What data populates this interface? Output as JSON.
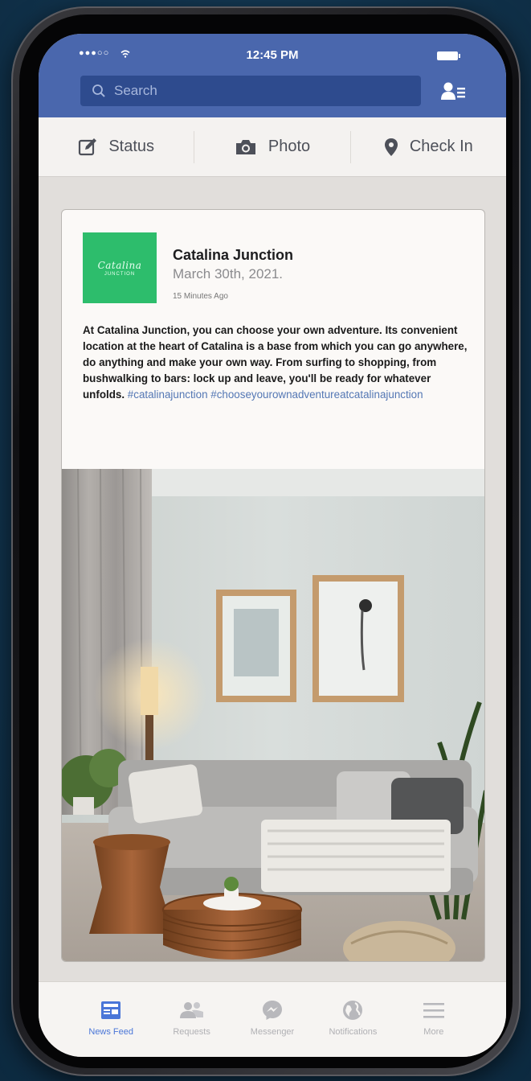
{
  "status_bar": {
    "signal": "●●●○○",
    "time": "12:45 PM"
  },
  "search": {
    "placeholder": "Search"
  },
  "actions": [
    {
      "label": "Status",
      "icon": "edit-icon"
    },
    {
      "label": "Photo",
      "icon": "camera-icon"
    },
    {
      "label": "Check In",
      "icon": "location-pin-icon"
    }
  ],
  "post": {
    "logo": {
      "line1": "Catalina",
      "line2": "JUNCTION"
    },
    "author": "Catalina Junction",
    "date": "March 30th, 2021.",
    "time_ago": "15 Minutes Ago",
    "text": "At Catalina Junction, you can choose your own adventure.  Its convenient location at the heart of Catalina is a base from which you can go anywhere, do anything and make your own way.  From surfing to shopping, from bushwalking to bars: lock up and leave, you'll be ready for whatever unfolds. ",
    "hashtags": "#catalinajunction #chooseyourownadventureatcatalinajunction",
    "image": "living-room-photo"
  },
  "tabs": [
    {
      "label": "News Feed",
      "icon": "news-feed-icon",
      "active": true
    },
    {
      "label": "Requests",
      "icon": "friend-requests-icon",
      "active": false
    },
    {
      "label": "Messenger",
      "icon": "messenger-icon",
      "active": false
    },
    {
      "label": "Notifications",
      "icon": "globe-icon",
      "active": false
    },
    {
      "label": "More",
      "icon": "menu-icon",
      "active": false
    }
  ],
  "colors": {
    "brand_blue": "#4a67ad",
    "search_bg": "#2e4b8e",
    "logo_green": "#2dbd6c",
    "hashtag": "#5477b4",
    "active_tab": "#4a76d8",
    "inactive_tab": "#b0b0b4"
  }
}
